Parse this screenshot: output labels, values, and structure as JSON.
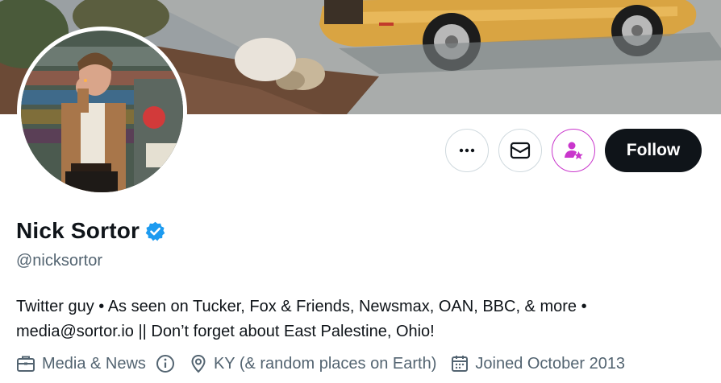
{
  "profile": {
    "display_name": "Nick Sortor",
    "handle": "@nicksortor",
    "verified": true,
    "bio_line1": "Twitter guy • As seen on Tucker, Fox & Friends, Newsmax, OAN, BBC, & more •",
    "bio_line2": "media@sortor.io || Don’t forget about East Palestine, Ohio!",
    "category": "Media & News",
    "location": "KY (& random places on Earth)",
    "joined": "Joined October 2013"
  },
  "actions": {
    "follow_label": "Follow"
  },
  "colors": {
    "verified_badge": "#1d9bf0",
    "subscribe_accent": "#c936cc",
    "follow_bg": "#0f1419",
    "secondary_text": "#536471"
  },
  "icons": {
    "more": "more-horizontal-icon",
    "message": "envelope-icon",
    "subscribe": "person-star-icon",
    "category": "briefcase-icon",
    "info": "info-circle-icon",
    "location": "location-pin-icon",
    "joined": "calendar-icon"
  }
}
